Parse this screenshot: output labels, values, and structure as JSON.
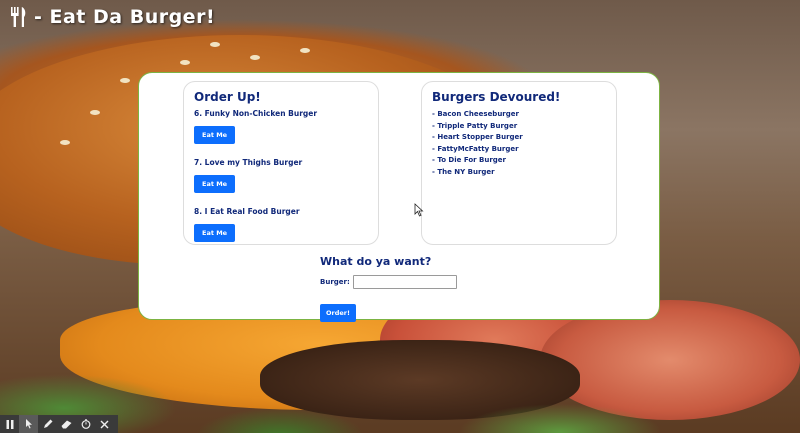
{
  "app": {
    "title": "- Eat Da Burger!",
    "icon": "fork-knife-icon"
  },
  "order_up": {
    "heading": "Order Up!",
    "items": [
      {
        "label": "6. Funky Non-Chicken Burger",
        "button": "Eat Me"
      },
      {
        "label": "7. Love my Thighs Burger",
        "button": "Eat Me"
      },
      {
        "label": "8. I Eat Real Food Burger",
        "button": "Eat Me"
      }
    ]
  },
  "devoured": {
    "heading": "Burgers Devoured!",
    "items": [
      "- Bacon Cheeseburger",
      "- Tripple Patty Burger",
      "- Heart Stopper Burger",
      "- FattyMcFatty Burger",
      "- To Die For Burger",
      "- The NY Burger"
    ]
  },
  "form": {
    "heading": "What do ya want?",
    "field_label": "Burger:",
    "field_value": "",
    "submit_label": "Order!"
  },
  "colors": {
    "heading": "#11297a",
    "button": "#0d6efd",
    "panel_border": "#7cb342"
  },
  "toolbar": {
    "tools": [
      "pause-icon",
      "pointer-icon",
      "pen-icon",
      "eraser-icon",
      "timer-icon",
      "close-icon"
    ]
  }
}
